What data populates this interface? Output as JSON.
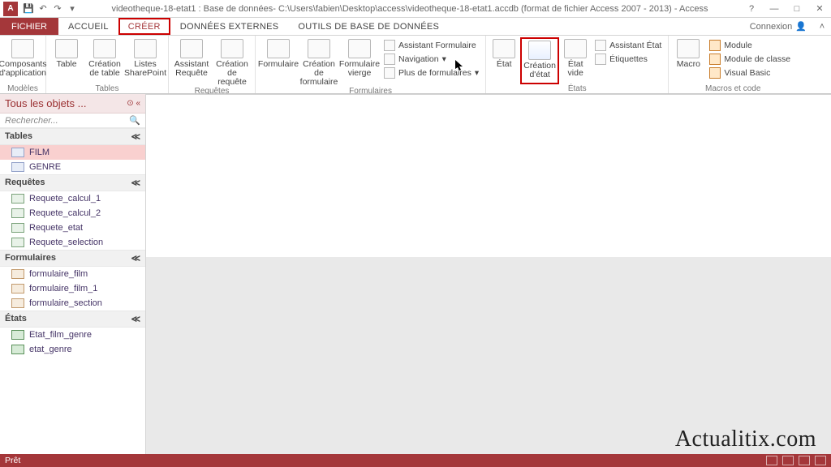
{
  "title_text": "videotheque-18-etat1 : Base de données- C:\\Users\\fabien\\Desktop\\access\\videotheque-18-etat1.accdb (format de fichier Access 2007 - 2013) - Access",
  "app_icon_letter": "A",
  "tabs": {
    "file": "FICHIER",
    "home": "ACCUEIL",
    "create": "CRÉER",
    "external": "DONNÉES EXTERNES",
    "dbtools": "OUTILS DE BASE DE DONNÉES"
  },
  "connexion": "Connexion",
  "ribbon": {
    "groups": {
      "models": "Modèles",
      "tables": "Tables",
      "queries": "Requêtes",
      "forms": "Formulaires",
      "reports": "États",
      "macros": "Macros et code"
    },
    "buttons": {
      "app_parts": "Composants d'application",
      "table": "Table",
      "table_design": "Création de table",
      "sharepoint": "Listes SharePoint",
      "query_wiz": "Assistant Requête",
      "query_design": "Création de requête",
      "form": "Formulaire",
      "form_design": "Création de formulaire",
      "blank_form": "Formulaire vierge",
      "form_wiz": "Assistant Formulaire",
      "navigation": "Navigation",
      "more_forms": "Plus de formulaires",
      "report": "État",
      "report_design": "Création d'état",
      "blank_report": "État vide",
      "report_wiz": "Assistant État",
      "labels": "Étiquettes",
      "macro": "Macro",
      "module": "Module",
      "class_module": "Module de classe",
      "vb": "Visual Basic"
    }
  },
  "nav": {
    "header": "Tous les objets ...",
    "search_placeholder": "Rechercher...",
    "groups": {
      "tables": "Tables",
      "queries": "Requêtes",
      "forms": "Formulaires",
      "reports": "États"
    },
    "items": {
      "film": "FILM",
      "genre": "GENRE",
      "rq1": "Requete_calcul_1",
      "rq2": "Requete_calcul_2",
      "rq3": "Requete_etat",
      "rq4": "Requete_selection",
      "f1": "formulaire_film",
      "f2": "formulaire_film_1",
      "f3": "formulaire_section",
      "r1": "Etat_film_genre",
      "r2": "etat_genre"
    }
  },
  "status": "Prêt",
  "watermark": "Actualitix.com"
}
